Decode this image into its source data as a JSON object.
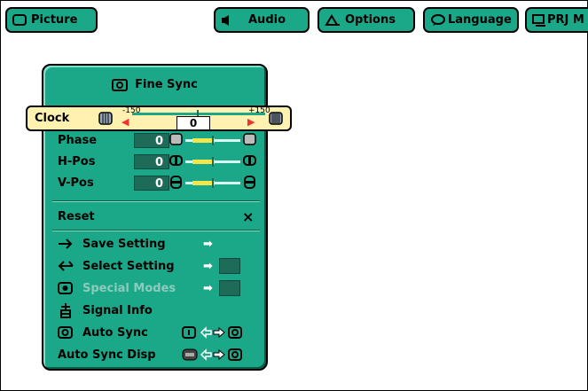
{
  "tabs": [
    {
      "label": "Picture",
      "icon": "screen-icon"
    },
    {
      "label": "Audio",
      "icon": "speaker-icon"
    },
    {
      "label": "Options",
      "icon": "options-icon"
    },
    {
      "label": "Language",
      "icon": "speech-bubble-icon"
    },
    {
      "label": "PRJ M",
      "icon": "projector-icon"
    }
  ],
  "panel": {
    "title": "Fine Sync",
    "clock": {
      "label": "Clock",
      "min": "-150",
      "max": "+150",
      "value": "0"
    },
    "adjust_rows": [
      {
        "label": "Phase",
        "value": "0"
      },
      {
        "label": "H-Pos",
        "value": "0"
      },
      {
        "label": "V-Pos",
        "value": "0"
      }
    ],
    "reset": {
      "label": "Reset",
      "mark": "×"
    },
    "menu_items": [
      {
        "label": "Save Setting",
        "arrow": "➡"
      },
      {
        "label": "Select Setting",
        "arrow": "➡"
      },
      {
        "label": "Special Modes",
        "arrow": "➡"
      },
      {
        "label": "Signal Info"
      },
      {
        "label": "Auto Sync"
      },
      {
        "label": "Auto Sync Disp"
      }
    ]
  },
  "colors": {
    "panel": "#1aa889",
    "highlight": "#fff2b0",
    "accent_red": "#e33",
    "knob": "#f3e54a"
  }
}
